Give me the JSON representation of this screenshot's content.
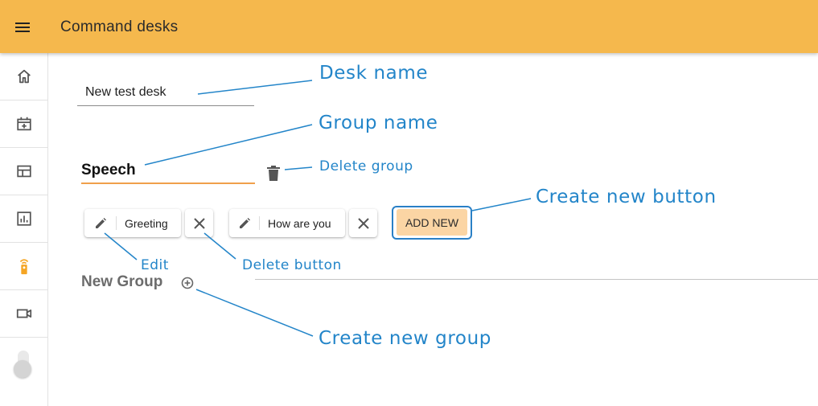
{
  "app": {
    "title": "Command desks"
  },
  "icons": {
    "menu": "menu-icon",
    "home": "home-icon",
    "add_event": "calendar-add-icon",
    "layout": "layout-icon",
    "chart": "bar-chart-icon",
    "remote": "remote-icon",
    "camera": "video-camera-icon",
    "edit": "pencil-icon",
    "close": "close-icon",
    "delete": "trash-icon",
    "add_circle": "add-circle-icon"
  },
  "colors": {
    "topbar": "#f5b84d",
    "accent": "#f0a04b",
    "active_nav": "#f5a524",
    "add_button": "#fbd5a4",
    "annotation": "#2385c9"
  },
  "desk": {
    "name_value": "New test desk"
  },
  "groups": [
    {
      "name_value": "Speech",
      "buttons": [
        {
          "label": "Greeting"
        },
        {
          "label": "How are you"
        }
      ],
      "add_label": "ADD NEW"
    }
  ],
  "new_group": {
    "label": "New Group"
  },
  "annotations": {
    "desk_name": "Desk name",
    "group_name": "Group name",
    "delete_group": "Delete group",
    "create_button": "Create new button",
    "edit": "Edit",
    "delete_button": "Delete button",
    "create_group": "Create new group"
  }
}
